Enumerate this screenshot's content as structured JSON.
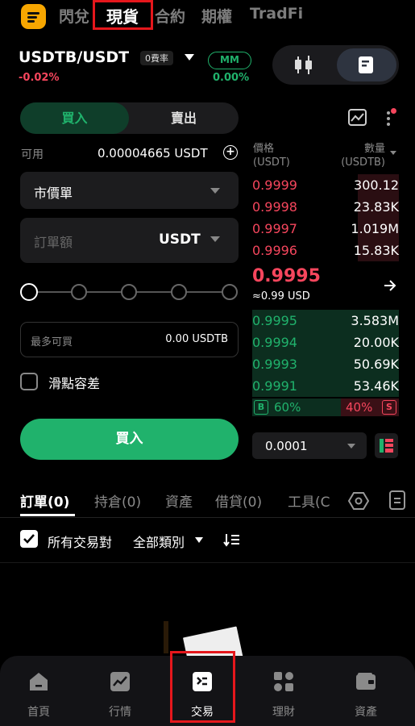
{
  "colors": {
    "buy_green": "#20b26c",
    "sell_red": "#f6465d",
    "highlight_red": "#e5171c",
    "brand_orange": "#f7a600"
  },
  "top_nav": {
    "tabs": [
      {
        "label": "閃兌",
        "active": false
      },
      {
        "label": "現貨",
        "active": true
      },
      {
        "label": "合約",
        "active": false
      },
      {
        "label": "期權",
        "active": false
      },
      {
        "label": "TradFi",
        "active": false
      }
    ]
  },
  "pair": {
    "symbol": "USDTB/USDT",
    "fee_badge": "0費率",
    "change": "-0.02%",
    "mm_label": "MM",
    "mm_value": "0.00%"
  },
  "order_form": {
    "tabs": {
      "buy": "買入",
      "sell": "賣出"
    },
    "available_label": "可用",
    "available_value": "0.00004665 USDT",
    "order_type": "市價單",
    "amount_placeholder": "訂單額",
    "amount_unit": "USDT",
    "slider_value_percent": 0,
    "max_buy_label": "最多可買",
    "max_buy_value": "0.00 USDTB",
    "slippage_label": "滑點容差",
    "slippage_checked": false,
    "submit_label": "買入"
  },
  "order_book": {
    "price_header": "價格",
    "price_unit": "(USDT)",
    "qty_header": "數量",
    "qty_unit": "(USDTB)",
    "asks": [
      {
        "price": "0.9999",
        "qty": "300.12",
        "depth": 0.28
      },
      {
        "price": "0.9998",
        "qty": "23.83K",
        "depth": 0.28
      },
      {
        "price": "0.9997",
        "qty": "1.019M",
        "depth": 0.28
      },
      {
        "price": "0.9996",
        "qty": "15.83K",
        "depth": 0.28
      }
    ],
    "last_price": "0.9995",
    "last_price_fiat": "≈0.99 USD",
    "bids": [
      {
        "price": "0.9995",
        "qty": "3.583M",
        "depth": 1.0
      },
      {
        "price": "0.9994",
        "qty": "20.00K",
        "depth": 1.0
      },
      {
        "price": "0.9993",
        "qty": "50.69K",
        "depth": 1.0
      },
      {
        "price": "0.9991",
        "qty": "53.46K",
        "depth": 1.0
      }
    ],
    "buy_badge": "B",
    "buy_ratio": "60%",
    "sell_ratio": "40%",
    "sell_badge": "S",
    "precision": "0.0001"
  },
  "bottom_tabs": [
    {
      "label": "訂單(0)",
      "active": true
    },
    {
      "label": "持倉(0)",
      "active": false
    },
    {
      "label": "資產",
      "active": false
    },
    {
      "label": "借貸(0)",
      "active": false
    },
    {
      "label": "工具(C",
      "active": false
    }
  ],
  "filters": {
    "all_pairs_label": "所有交易對",
    "all_pairs_checked": true,
    "category_label": "全部類別"
  },
  "bottom_nav": [
    {
      "label": "首頁",
      "icon": "home-icon"
    },
    {
      "label": "行情",
      "icon": "market-chart-icon"
    },
    {
      "label": "交易",
      "icon": "trade-icon"
    },
    {
      "label": "理財",
      "icon": "earn-icon"
    },
    {
      "label": "資產",
      "icon": "wallet-icon"
    }
  ]
}
